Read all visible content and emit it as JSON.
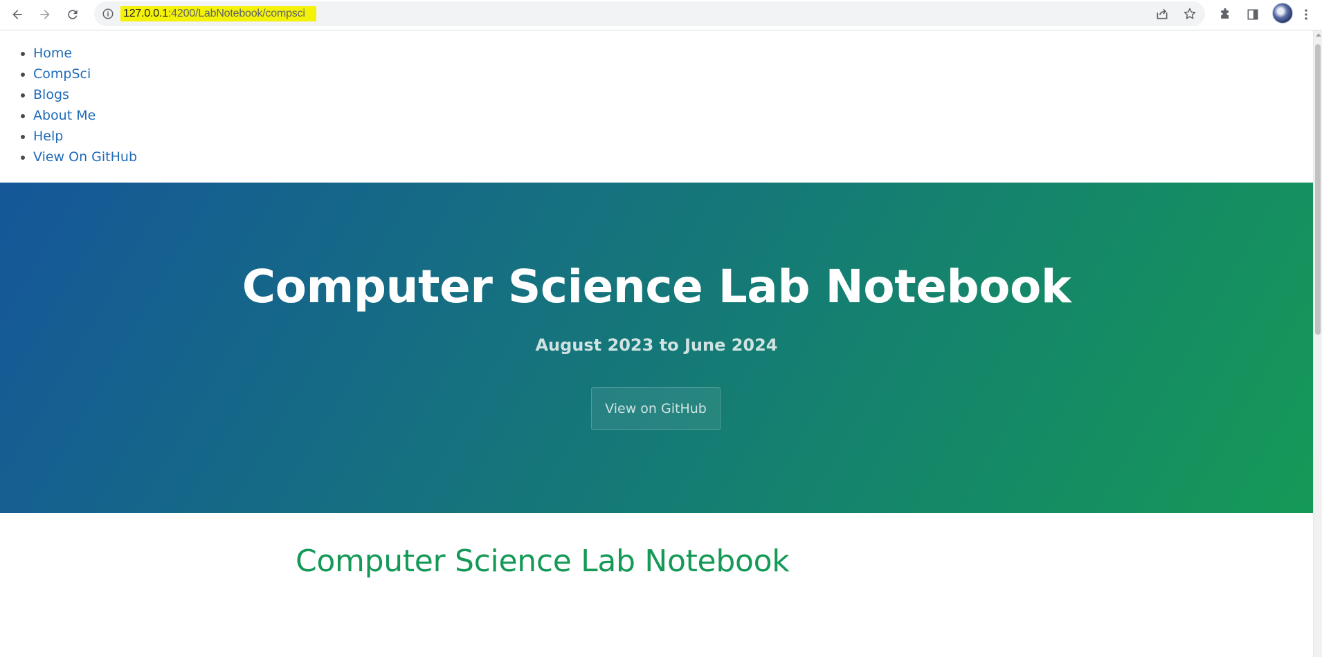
{
  "browser": {
    "url_host": "127.0.0.1",
    "url_path": ":4200/LabNotebook/compsci",
    "icons": {
      "back": "back-arrow-icon",
      "forward": "forward-arrow-icon",
      "reload": "reload-icon",
      "site_info": "info-icon",
      "share": "share-icon",
      "bookmark": "star-icon",
      "extensions": "puzzle-icon",
      "side_panel": "side-panel-icon",
      "menu": "kebab-menu-icon"
    },
    "highlight_color": "#f5f20a"
  },
  "nav": {
    "items": [
      {
        "label": "Home"
      },
      {
        "label": "CompSci"
      },
      {
        "label": "Blogs"
      },
      {
        "label": "About Me"
      },
      {
        "label": "Help"
      },
      {
        "label": "View On GitHub"
      }
    ],
    "link_color": "#1e6bb8"
  },
  "hero": {
    "title": "Computer Science Lab Notebook",
    "tagline": "August 2023 to June 2024",
    "button_label": "View on GitHub",
    "gradient_start": "#155799",
    "gradient_end": "#159957"
  },
  "main": {
    "heading": "Computer Science Lab Notebook",
    "heading_color": "#159957"
  }
}
